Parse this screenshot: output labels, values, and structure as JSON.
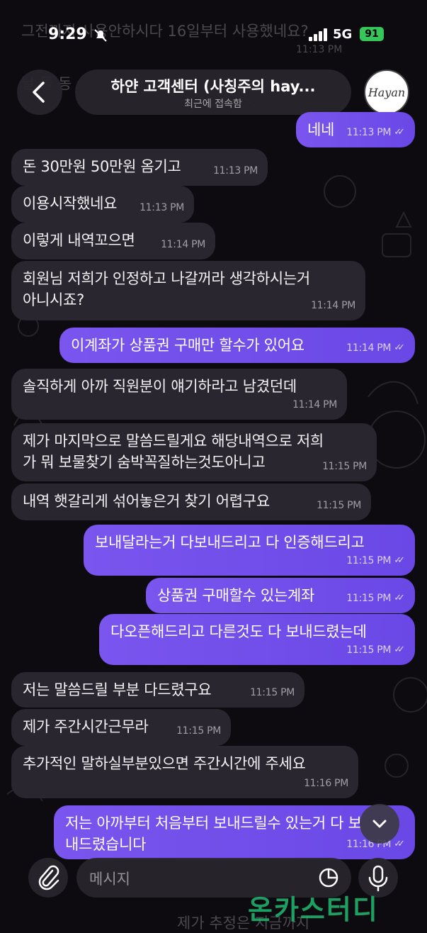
{
  "status_bar": {
    "time": "9:29",
    "network": "5G",
    "battery": "91"
  },
  "header": {
    "title": "하얀 고객센터 (사칭주의 hay...",
    "subtitle": "최근에 접속함",
    "avatar_text": "Hayan"
  },
  "ghost_text": {
    "top_line": "그전까지 사용안하시다 16일부터 사용했네요?",
    "top_time": "11:13 PM",
    "partial_left": "제가 추정은 지금까지"
  },
  "messages": [
    {
      "dir": "out",
      "text": "네네",
      "time": "11:13 PM",
      "read": true
    },
    {
      "dir": "in",
      "text": "돈 30만원 50만원 옴기고",
      "time": "11:13 PM"
    },
    {
      "dir": "in",
      "text": "이용시작했네요",
      "time": "11:13 PM"
    },
    {
      "dir": "in",
      "text": "이렇게 내역꼬으면",
      "time": "11:14 PM"
    },
    {
      "dir": "in",
      "text": "회원님 저희가 인정하고 나갈꺼라 생각하시는거\n아니시죠?",
      "time": "11:14 PM"
    },
    {
      "dir": "out",
      "text": "이계좌가 상품권 구매만 할수가 있어요",
      "time": "11:14 PM",
      "read": true
    },
    {
      "dir": "in",
      "text": "솔직하게 아까 직원분이 얘기하라고 남겼던데",
      "time": "11:14 PM"
    },
    {
      "dir": "in",
      "text": "제가 마지막으로 말씀드릴게요 해당내역으로 저희\n가 뭐 보물찾기 숨박꼭질하는것도아니고",
      "time": "11:15 PM"
    },
    {
      "dir": "in",
      "text": "내역 햇갈리게 섞어놓은거 찾기 어렵구요",
      "time": "11:15 PM"
    },
    {
      "dir": "out",
      "text": "보내달라는거 다보내드리고 다 인증해드리고",
      "time": "11:15 PM",
      "read": true
    },
    {
      "dir": "out",
      "text": "상품권 구매할수 있는계좌",
      "time": "11:15 PM",
      "read": true
    },
    {
      "dir": "out",
      "text": "다오픈해드리고 다른것도 다 보내드렸는데",
      "time": "11:15 PM",
      "read": true
    },
    {
      "dir": "in",
      "text": "저는 말씀드릴 부분 다드렸구요",
      "time": "11:15 PM"
    },
    {
      "dir": "in",
      "text": "제가 주간시간근무라",
      "time": "11:15 PM"
    },
    {
      "dir": "in",
      "text": "추가적인 말하실부분있으면 주간시간에 주세요",
      "time": "11:16 PM"
    },
    {
      "dir": "out",
      "text": "저는 아까부터 처음부터 보내드릴수 있는거 다 보\n내드렸습니다",
      "time": "11:16 PM",
      "read": true
    }
  ],
  "composer": {
    "placeholder": "메시지",
    "attach_icon": "paperclip-icon",
    "sticker_icon": "sticker-icon",
    "mic_icon": "microphone-icon"
  },
  "watermark": "온카스터디",
  "colors": {
    "incoming_bubble": "#2a2630",
    "outgoing_bubble": "#6f4cea",
    "background": "#0d0b10",
    "battery": "#35c759"
  }
}
